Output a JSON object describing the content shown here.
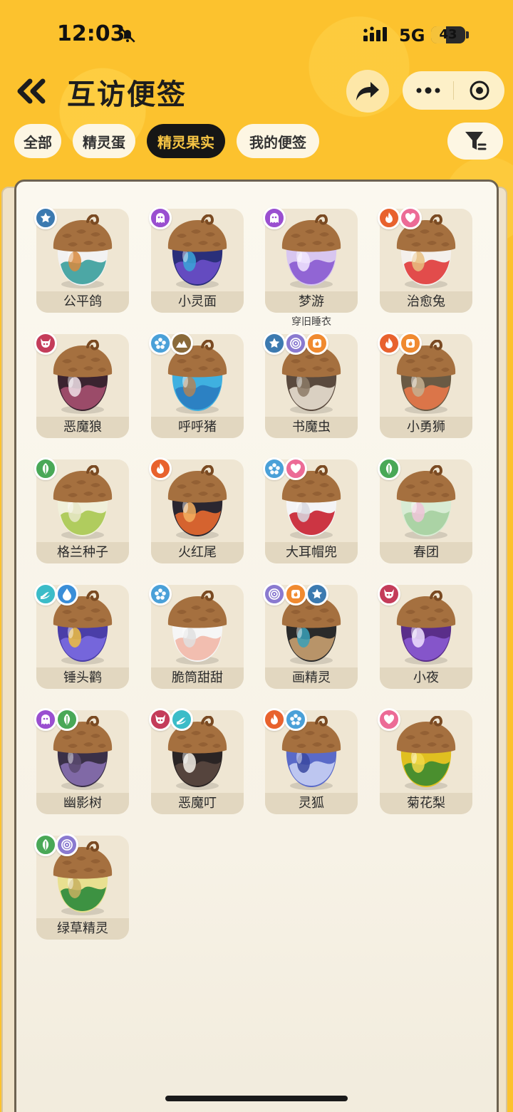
{
  "status": {
    "time": "12:03",
    "network": "5G",
    "battery": "43",
    "battery_level": 0.43
  },
  "header": {
    "title": "互访便签"
  },
  "tabs": [
    {
      "label": "全部",
      "active": false
    },
    {
      "label": "精灵蛋",
      "active": false
    },
    {
      "label": "精灵果实",
      "active": true
    },
    {
      "label": "我的便签",
      "active": false
    }
  ],
  "colors": {
    "accent": "#fcc22e",
    "active_tab_bg": "#161616",
    "active_tab_text": "#f7c544",
    "badge": {
      "star": "#3c7ab0",
      "ghost": "#9a4fd0",
      "fire": "#e8622e",
      "heart": "#ec6b96",
      "demon": "#c43c5a",
      "flower": "#4aa0d8",
      "mountain": "#8a6a3a",
      "swirl": "#8a7ad0",
      "flame": "#f08a30",
      "leaf": "#49a857",
      "wind": "#3bbcc8",
      "drop": "#3a8ed8"
    }
  },
  "items": [
    {
      "name": "公平鸽",
      "sub": "",
      "badges": [
        "star-icon"
      ],
      "palette": [
        "#f2f2f2",
        "#3a9f9c",
        "#d88a3e"
      ]
    },
    {
      "name": "小灵面",
      "sub": "",
      "badges": [
        "ghost-icon"
      ],
      "palette": [
        "#2a2f7a",
        "#6a4fc8",
        "#3ba4d8"
      ]
    },
    {
      "name": "梦游",
      "sub": "穿旧睡衣",
      "badges": [
        "ghost-icon"
      ],
      "palette": [
        "#d8c6f0",
        "#8a5ad0",
        "#f2e6ff"
      ]
    },
    {
      "name": "治愈兔",
      "sub": "",
      "badges": [
        "fire-icon",
        "heart-icon"
      ],
      "palette": [
        "#f4f0ec",
        "#e03a3a",
        "#e8c080"
      ]
    },
    {
      "name": "恶魔狼",
      "sub": "",
      "badges": [
        "demon-icon"
      ],
      "palette": [
        "#3b2430",
        "#a65070",
        "#f0e0e8"
      ]
    },
    {
      "name": "呼呼猪",
      "sub": "",
      "badges": [
        "flower-icon",
        "mountain-icon"
      ],
      "palette": [
        "#3fb0e0",
        "#2a7cc0",
        "#b08458"
      ]
    },
    {
      "name": "书魔虫",
      "sub": "",
      "badges": [
        "star-icon",
        "swirl-icon",
        "flame-icon"
      ],
      "palette": [
        "#5a4a3e",
        "#e8dfd0",
        "#8c7a66"
      ]
    },
    {
      "name": "小勇狮",
      "sub": "",
      "badges": [
        "fire-icon",
        "flame-icon"
      ],
      "palette": [
        "#6a5a44",
        "#e8784a",
        "#c4b090"
      ]
    },
    {
      "name": "格兰种子",
      "sub": "",
      "badges": [
        "leaf-icon"
      ],
      "palette": [
        "#f0f0da",
        "#a8c850",
        "#e8e8c8"
      ]
    },
    {
      "name": "火红尾",
      "sub": "",
      "badges": [
        "fire-icon"
      ],
      "palette": [
        "#2a2630",
        "#e86a30",
        "#f4b060"
      ]
    },
    {
      "name": "大耳帽兜",
      "sub": "",
      "badges": [
        "flower-icon",
        "heart-icon"
      ],
      "palette": [
        "#f4f4f6",
        "#c82030",
        "#d8d8e0"
      ]
    },
    {
      "name": "春团",
      "sub": "",
      "badges": [
        "leaf-icon"
      ],
      "palette": [
        "#d8ecd4",
        "#a6d0a0",
        "#f0c4d8"
      ]
    },
    {
      "name": "锤头鹳",
      "sub": "",
      "badges": [
        "wind-icon",
        "drop-icon"
      ],
      "palette": [
        "#4a3ea8",
        "#7a6ae0",
        "#f0c040"
      ]
    },
    {
      "name": "脆筒甜甜",
      "sub": "",
      "badges": [
        "flower-icon"
      ],
      "palette": [
        "#f6f6f6",
        "#f2b8a8",
        "#e0e0e0"
      ]
    },
    {
      "name": "画精灵",
      "sub": "",
      "badges": [
        "swirl-icon",
        "flame-icon",
        "star-icon"
      ],
      "palette": [
        "#2a2a2a",
        "#c8a070",
        "#3aa0b8"
      ]
    },
    {
      "name": "小夜",
      "sub": "",
      "badges": [
        "demon-icon"
      ],
      "palette": [
        "#5a2e8a",
        "#8a5ad0",
        "#f0e0ff"
      ]
    },
    {
      "name": "幽影树",
      "sub": "",
      "badges": [
        "ghost-icon",
        "leaf-icon"
      ],
      "palette": [
        "#3a3048",
        "#8870b0",
        "#5a4a70"
      ]
    },
    {
      "name": "恶魔叮",
      "sub": "",
      "badges": [
        "demon-icon",
        "wind-icon"
      ],
      "palette": [
        "#2a2424",
        "#5a4840",
        "#f4f0e8"
      ]
    },
    {
      "name": "灵狐",
      "sub": "",
      "badges": [
        "fire-icon",
        "flower-icon"
      ],
      "palette": [
        "#5a6ac8",
        "#c8d0f4",
        "#3a48a0"
      ]
    },
    {
      "name": "菊花梨",
      "sub": "",
      "badges": [
        "heart-icon"
      ],
      "palette": [
        "#e0c020",
        "#3a8a30",
        "#f0d848"
      ]
    },
    {
      "name": "绿草精灵",
      "sub": "",
      "badges": [
        "leaf-icon",
        "swirl-icon"
      ],
      "palette": [
        "#e8e090",
        "#2a8a3a",
        "#c8b060"
      ]
    }
  ]
}
